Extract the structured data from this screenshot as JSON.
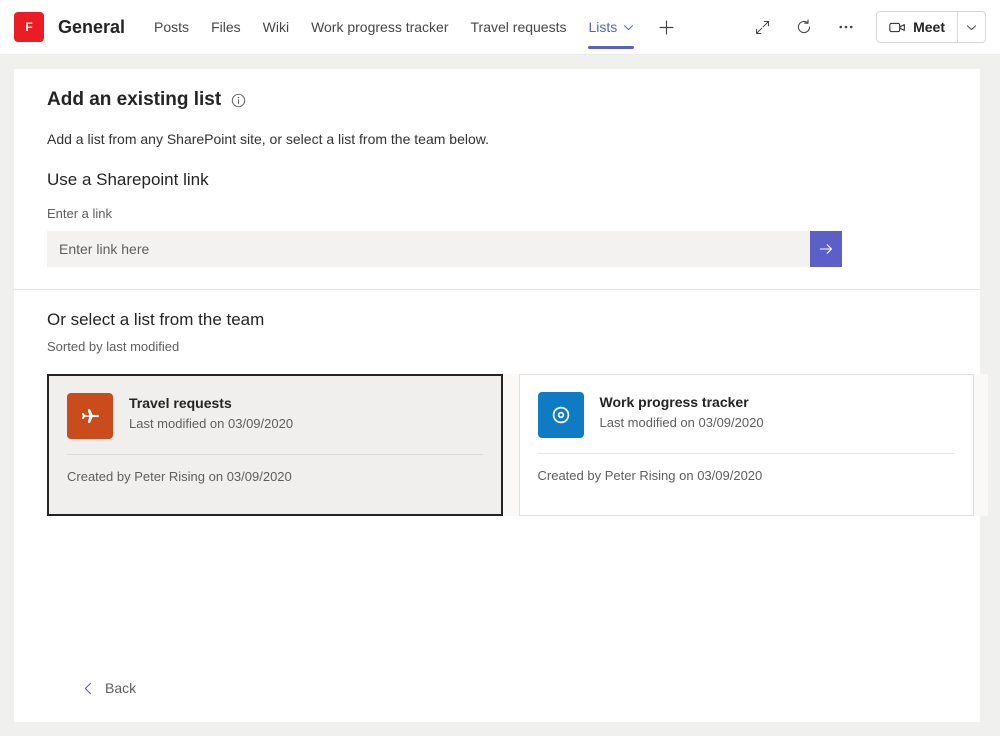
{
  "header": {
    "team_avatar_letter": "F",
    "channel_name": "General",
    "tabs": [
      {
        "label": "Posts",
        "active": false,
        "has_chevron": false
      },
      {
        "label": "Files",
        "active": false,
        "has_chevron": false
      },
      {
        "label": "Wiki",
        "active": false,
        "has_chevron": false
      },
      {
        "label": "Work progress tracker",
        "active": false,
        "has_chevron": false
      },
      {
        "label": "Travel requests",
        "active": false,
        "has_chevron": false
      },
      {
        "label": "Lists",
        "active": true,
        "has_chevron": true
      }
    ],
    "add_tab_label": "+",
    "icons": {
      "expand": "expand-icon",
      "refresh": "refresh-icon",
      "more": "more-options-icon"
    },
    "meet": {
      "label": "Meet",
      "camera_icon": "video-camera-icon",
      "chevron_icon": "chevron-down-icon"
    }
  },
  "main": {
    "title": "Add an existing list",
    "title_info_icon": "info-circle-icon",
    "description": "Add a list from any SharePoint site, or select a list from the team below.",
    "sharepoint_section": {
      "heading": "Use a Sharepoint link",
      "field_label": "Enter a link",
      "input_value": "",
      "input_placeholder": "Enter link here",
      "submit_icon": "arrow-right-icon"
    },
    "team_lists_section": {
      "heading": "Or select a list from the team",
      "sorted_by": "Sorted by last modified",
      "cards": [
        {
          "title": "Travel requests",
          "modified": "Last modified on 03/09/2020",
          "created": "Created by Peter Rising on 03/09/2020",
          "icon": "airplane-icon",
          "icon_color": "#ca4b1c",
          "selected": true
        },
        {
          "title": "Work progress tracker",
          "modified": "Last modified on 03/09/2020",
          "created": "Created by Peter Rising on 03/09/2020",
          "icon": "target-icon",
          "icon_color": "#0f7bc4",
          "selected": false
        }
      ]
    },
    "back_button": {
      "label": "Back",
      "icon": "chevron-left-icon"
    }
  },
  "colors": {
    "accent_purple": "#5b5fc7",
    "team_avatar_red": "#ec1c24",
    "panel_white": "#ffffff",
    "app_background": "#f0f0ef"
  }
}
